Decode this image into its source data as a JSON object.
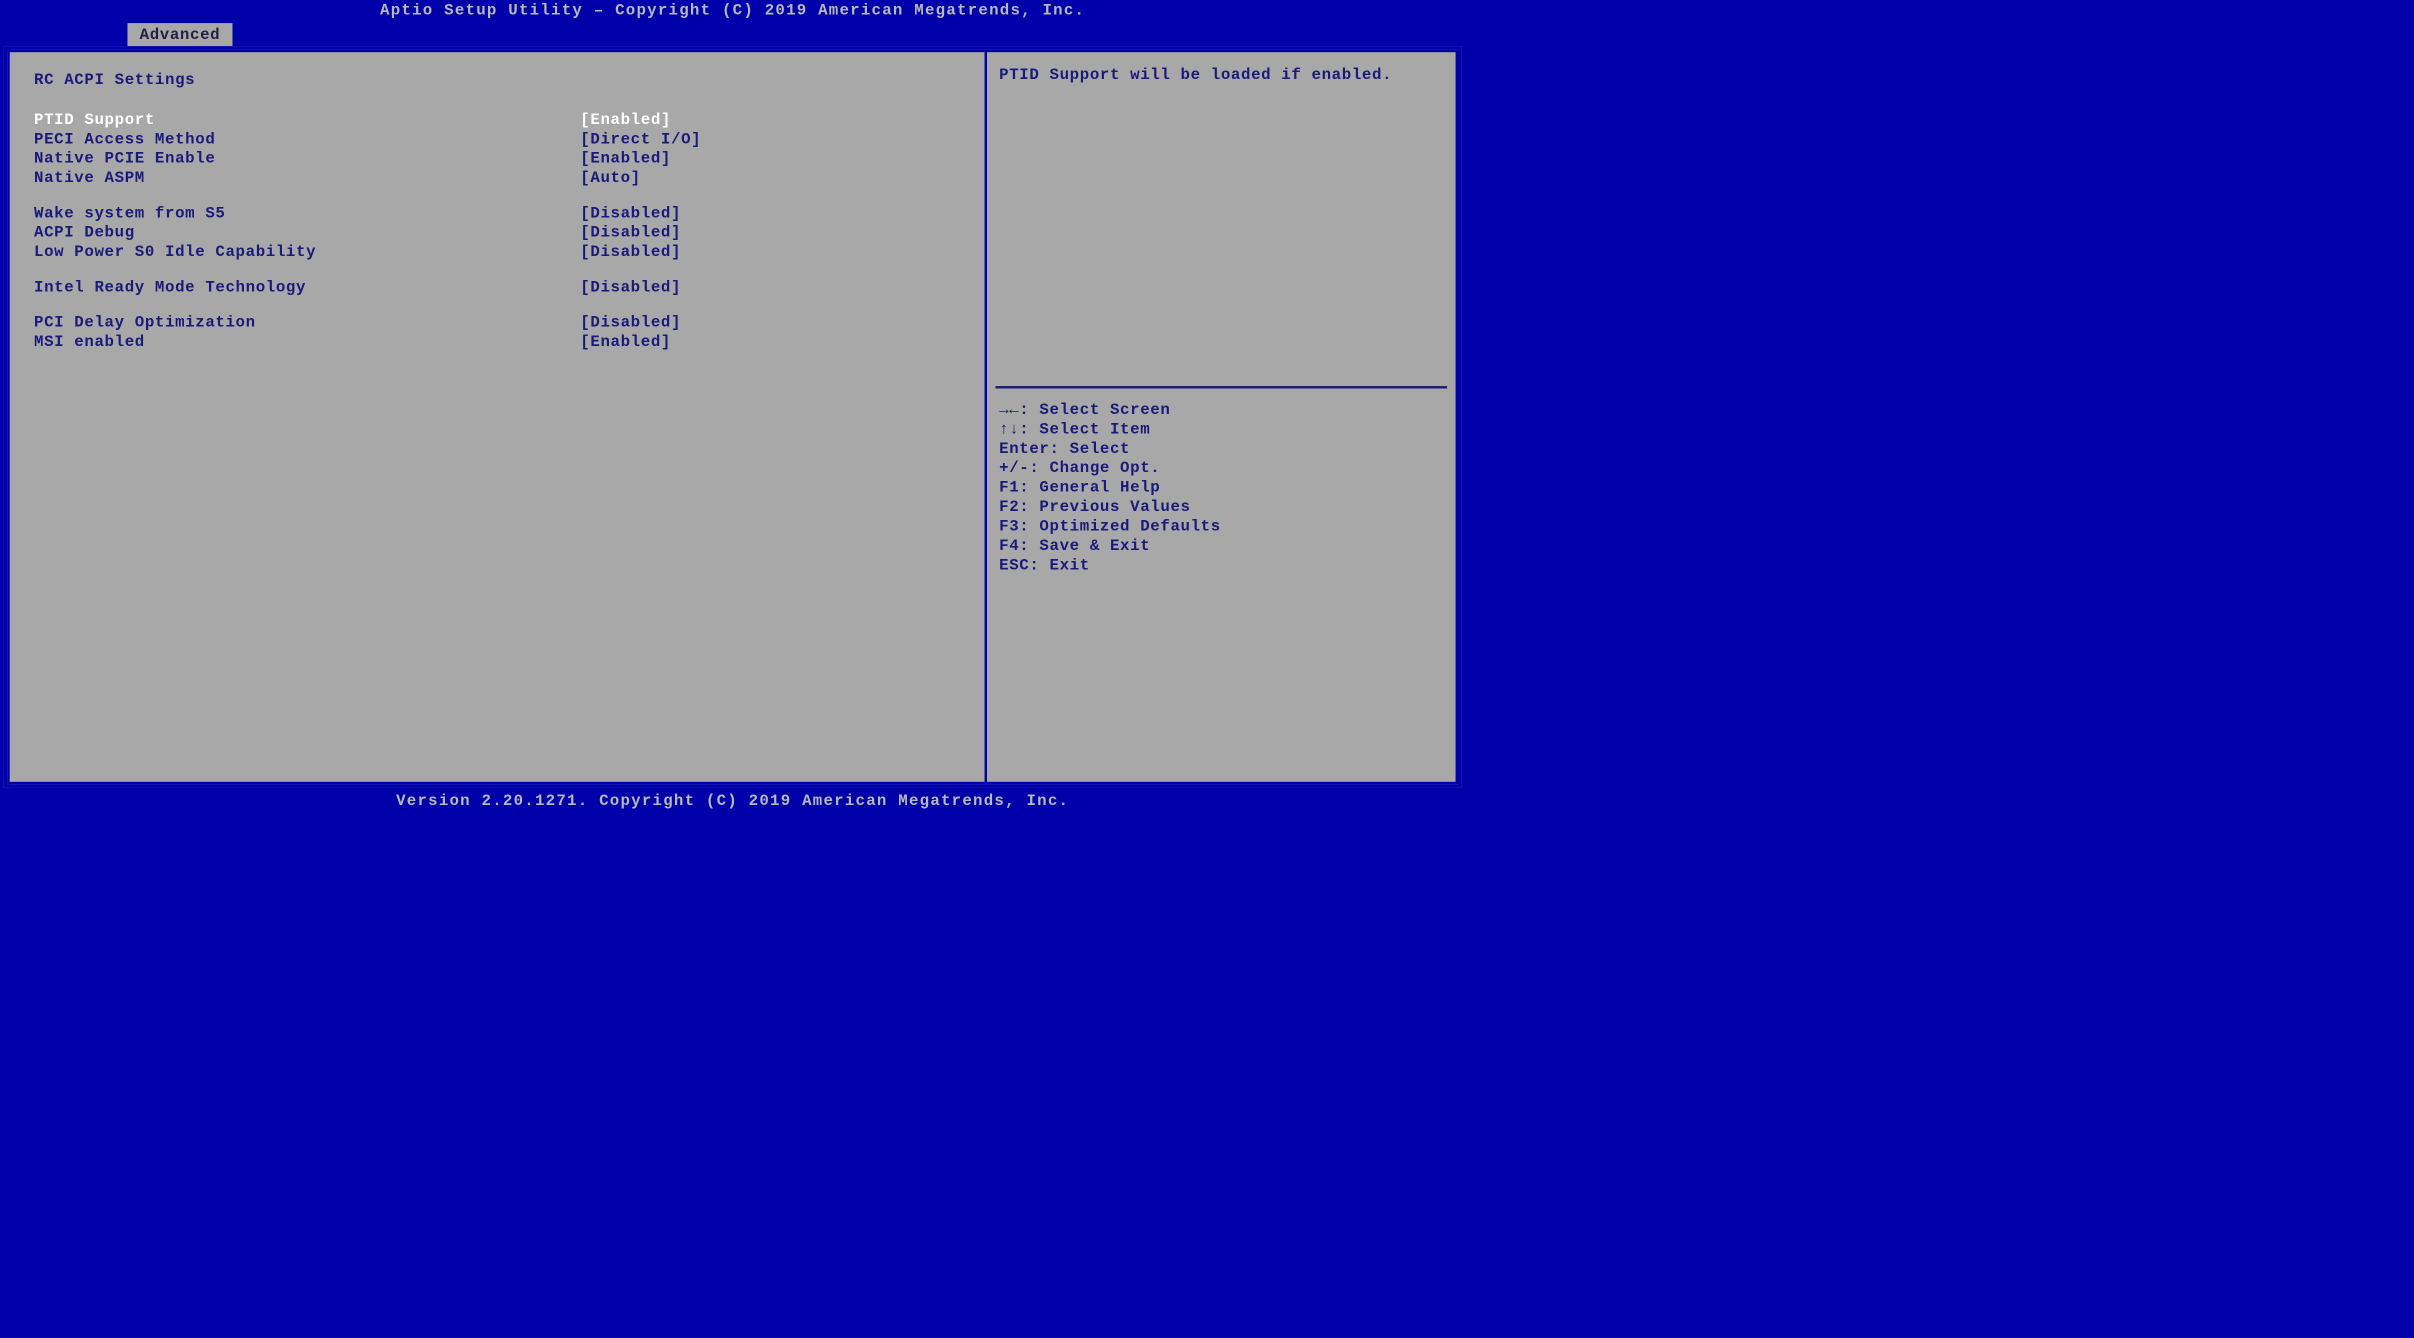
{
  "header": {
    "title": "Aptio Setup Utility – Copyright (C) 2019 American Megatrends, Inc."
  },
  "tabs": {
    "active": "Advanced"
  },
  "main": {
    "section_title": "RC ACPI Settings",
    "settings": [
      {
        "label": "PTID Support",
        "value": "[Enabled]",
        "selected": true
      },
      {
        "label": "PECI Access Method",
        "value": "[Direct I/O]",
        "selected": false
      },
      {
        "label": "Native PCIE Enable",
        "value": "[Enabled]",
        "selected": false
      },
      {
        "label": "Native ASPM",
        "value": "[Auto]",
        "selected": false
      },
      {
        "spacer": true
      },
      {
        "label": "Wake system from S5",
        "value": "[Disabled]",
        "selected": false
      },
      {
        "label": "ACPI Debug",
        "value": "[Disabled]",
        "selected": false
      },
      {
        "label": "Low Power S0 Idle Capability",
        "value": "[Disabled]",
        "selected": false
      },
      {
        "spacer": true
      },
      {
        "label": "Intel Ready Mode Technology",
        "value": "[Disabled]",
        "selected": false
      },
      {
        "spacer": true
      },
      {
        "label": "PCI Delay Optimization",
        "value": "[Disabled]",
        "selected": false
      },
      {
        "label": "MSI enabled",
        "value": "[Enabled]",
        "selected": false
      }
    ]
  },
  "help": {
    "text": "PTID Support will be loaded if enabled."
  },
  "keys": [
    "→←: Select Screen",
    "↑↓: Select Item",
    "Enter: Select",
    "+/-: Change Opt.",
    "F1: General Help",
    "F2: Previous Values",
    "F3: Optimized Defaults",
    "F4: Save & Exit",
    "ESC: Exit"
  ],
  "footer": {
    "text": "Version 2.20.1271. Copyright (C) 2019 American Megatrends, Inc."
  }
}
